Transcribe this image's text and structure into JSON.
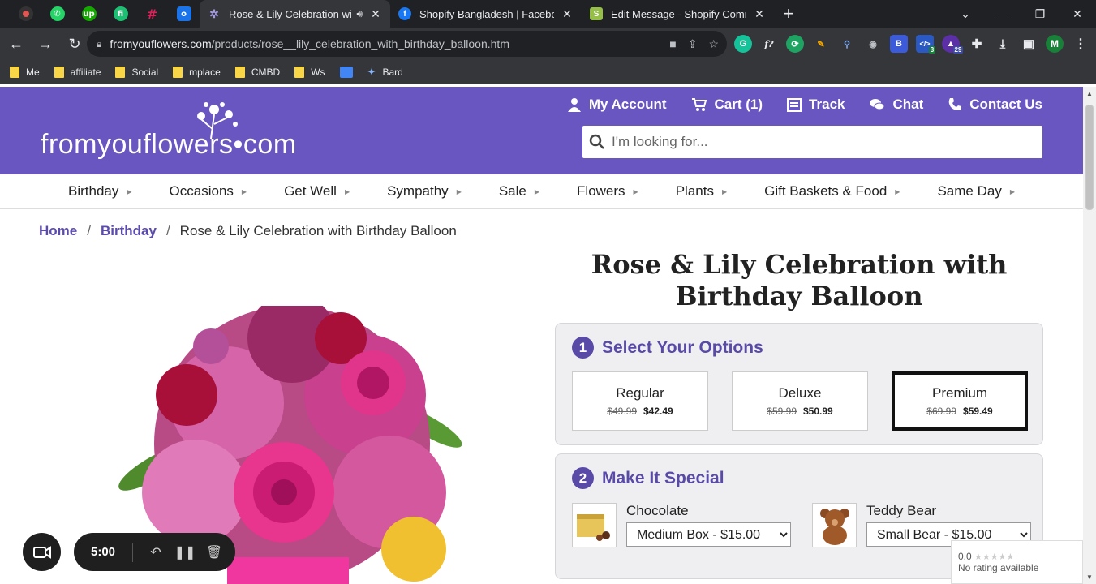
{
  "browser": {
    "tabs": [
      {
        "title": "Rose & Lily Celebration with",
        "active": true
      },
      {
        "title": "Shopify Bangladesh | Facebook",
        "active": false
      },
      {
        "title": "Edit Message - Shopify Commun",
        "active": false
      }
    ],
    "url_host": "fromyouflowers.com",
    "url_path": "/products/rose__lily_celebration_with_birthday_balloon.htm",
    "bookmarks": [
      "Me",
      "affiliate",
      "Social",
      "mplace",
      "CMBD",
      "Ws",
      "",
      "Bard"
    ],
    "profile_initial": "M",
    "ext_badge_1": "3",
    "ext_badge_2": "29"
  },
  "site": {
    "logo_text": "fromyouflowers•com",
    "top_links": {
      "account": "My Account",
      "cart": "Cart (1)",
      "track": "Track",
      "chat": "Chat",
      "contact": "Contact Us"
    },
    "search_placeholder": "I'm looking for...",
    "categories": [
      "Birthday",
      "Occasions",
      "Get Well",
      "Sympathy",
      "Sale",
      "Flowers",
      "Plants",
      "Gift Baskets & Food",
      "Same Day"
    ]
  },
  "breadcrumb": {
    "home": "Home",
    "category": "Birthday",
    "current": "Rose & Lily Celebration with Birthday Balloon"
  },
  "product": {
    "title": "Rose & Lily Celebration with Birthday Balloon",
    "step1": {
      "num": "1",
      "heading": "Select Your Options"
    },
    "options": [
      {
        "name": "Regular",
        "old": "$49.99",
        "new": "$42.49",
        "selected": false
      },
      {
        "name": "Deluxe",
        "old": "$59.99",
        "new": "$50.99",
        "selected": false
      },
      {
        "name": "Premium",
        "old": "$69.99",
        "new": "$59.49",
        "selected": true
      }
    ],
    "step2": {
      "num": "2",
      "heading": "Make It Special"
    },
    "addons": [
      {
        "label": "Chocolate",
        "selected": "Medium Box - $15.00"
      },
      {
        "label": "Teddy Bear",
        "selected": "Small Bear - $15.00"
      }
    ]
  },
  "rating": {
    "score": "0.0",
    "text": "No rating available"
  },
  "recorder": {
    "time": "5:00"
  },
  "colors": {
    "brand": "#6a56c0",
    "accent": "#5a4aa8"
  }
}
